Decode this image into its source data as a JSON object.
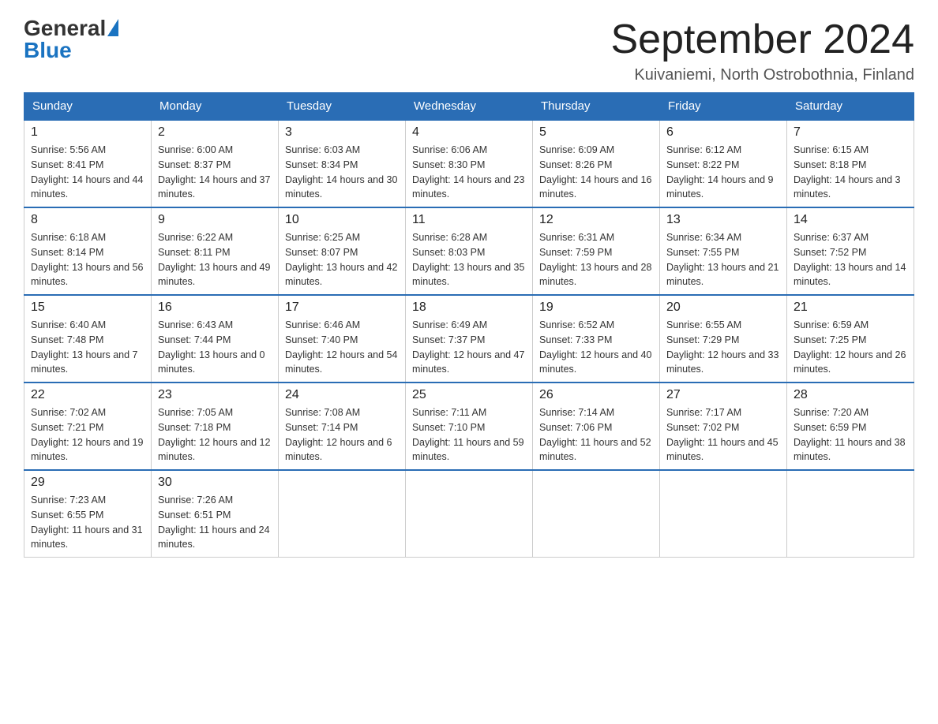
{
  "header": {
    "logo_general": "General",
    "logo_blue": "Blue",
    "month_title": "September 2024",
    "location": "Kuivaniemi, North Ostrobothnia, Finland"
  },
  "weekdays": [
    "Sunday",
    "Monday",
    "Tuesday",
    "Wednesday",
    "Thursday",
    "Friday",
    "Saturday"
  ],
  "weeks": [
    [
      {
        "day": "1",
        "sunrise": "5:56 AM",
        "sunset": "8:41 PM",
        "daylight": "14 hours and 44 minutes."
      },
      {
        "day": "2",
        "sunrise": "6:00 AM",
        "sunset": "8:37 PM",
        "daylight": "14 hours and 37 minutes."
      },
      {
        "day": "3",
        "sunrise": "6:03 AM",
        "sunset": "8:34 PM",
        "daylight": "14 hours and 30 minutes."
      },
      {
        "day": "4",
        "sunrise": "6:06 AM",
        "sunset": "8:30 PM",
        "daylight": "14 hours and 23 minutes."
      },
      {
        "day": "5",
        "sunrise": "6:09 AM",
        "sunset": "8:26 PM",
        "daylight": "14 hours and 16 minutes."
      },
      {
        "day": "6",
        "sunrise": "6:12 AM",
        "sunset": "8:22 PM",
        "daylight": "14 hours and 9 minutes."
      },
      {
        "day": "7",
        "sunrise": "6:15 AM",
        "sunset": "8:18 PM",
        "daylight": "14 hours and 3 minutes."
      }
    ],
    [
      {
        "day": "8",
        "sunrise": "6:18 AM",
        "sunset": "8:14 PM",
        "daylight": "13 hours and 56 minutes."
      },
      {
        "day": "9",
        "sunrise": "6:22 AM",
        "sunset": "8:11 PM",
        "daylight": "13 hours and 49 minutes."
      },
      {
        "day": "10",
        "sunrise": "6:25 AM",
        "sunset": "8:07 PM",
        "daylight": "13 hours and 42 minutes."
      },
      {
        "day": "11",
        "sunrise": "6:28 AM",
        "sunset": "8:03 PM",
        "daylight": "13 hours and 35 minutes."
      },
      {
        "day": "12",
        "sunrise": "6:31 AM",
        "sunset": "7:59 PM",
        "daylight": "13 hours and 28 minutes."
      },
      {
        "day": "13",
        "sunrise": "6:34 AM",
        "sunset": "7:55 PM",
        "daylight": "13 hours and 21 minutes."
      },
      {
        "day": "14",
        "sunrise": "6:37 AM",
        "sunset": "7:52 PM",
        "daylight": "13 hours and 14 minutes."
      }
    ],
    [
      {
        "day": "15",
        "sunrise": "6:40 AM",
        "sunset": "7:48 PM",
        "daylight": "13 hours and 7 minutes."
      },
      {
        "day": "16",
        "sunrise": "6:43 AM",
        "sunset": "7:44 PM",
        "daylight": "13 hours and 0 minutes."
      },
      {
        "day": "17",
        "sunrise": "6:46 AM",
        "sunset": "7:40 PM",
        "daylight": "12 hours and 54 minutes."
      },
      {
        "day": "18",
        "sunrise": "6:49 AM",
        "sunset": "7:37 PM",
        "daylight": "12 hours and 47 minutes."
      },
      {
        "day": "19",
        "sunrise": "6:52 AM",
        "sunset": "7:33 PM",
        "daylight": "12 hours and 40 minutes."
      },
      {
        "day": "20",
        "sunrise": "6:55 AM",
        "sunset": "7:29 PM",
        "daylight": "12 hours and 33 minutes."
      },
      {
        "day": "21",
        "sunrise": "6:59 AM",
        "sunset": "7:25 PM",
        "daylight": "12 hours and 26 minutes."
      }
    ],
    [
      {
        "day": "22",
        "sunrise": "7:02 AM",
        "sunset": "7:21 PM",
        "daylight": "12 hours and 19 minutes."
      },
      {
        "day": "23",
        "sunrise": "7:05 AM",
        "sunset": "7:18 PM",
        "daylight": "12 hours and 12 minutes."
      },
      {
        "day": "24",
        "sunrise": "7:08 AM",
        "sunset": "7:14 PM",
        "daylight": "12 hours and 6 minutes."
      },
      {
        "day": "25",
        "sunrise": "7:11 AM",
        "sunset": "7:10 PM",
        "daylight": "11 hours and 59 minutes."
      },
      {
        "day": "26",
        "sunrise": "7:14 AM",
        "sunset": "7:06 PM",
        "daylight": "11 hours and 52 minutes."
      },
      {
        "day": "27",
        "sunrise": "7:17 AM",
        "sunset": "7:02 PM",
        "daylight": "11 hours and 45 minutes."
      },
      {
        "day": "28",
        "sunrise": "7:20 AM",
        "sunset": "6:59 PM",
        "daylight": "11 hours and 38 minutes."
      }
    ],
    [
      {
        "day": "29",
        "sunrise": "7:23 AM",
        "sunset": "6:55 PM",
        "daylight": "11 hours and 31 minutes."
      },
      {
        "day": "30",
        "sunrise": "7:26 AM",
        "sunset": "6:51 PM",
        "daylight": "11 hours and 24 minutes."
      },
      null,
      null,
      null,
      null,
      null
    ]
  ],
  "labels": {
    "sunrise_prefix": "Sunrise: ",
    "sunset_prefix": "Sunset: ",
    "daylight_prefix": "Daylight: "
  }
}
